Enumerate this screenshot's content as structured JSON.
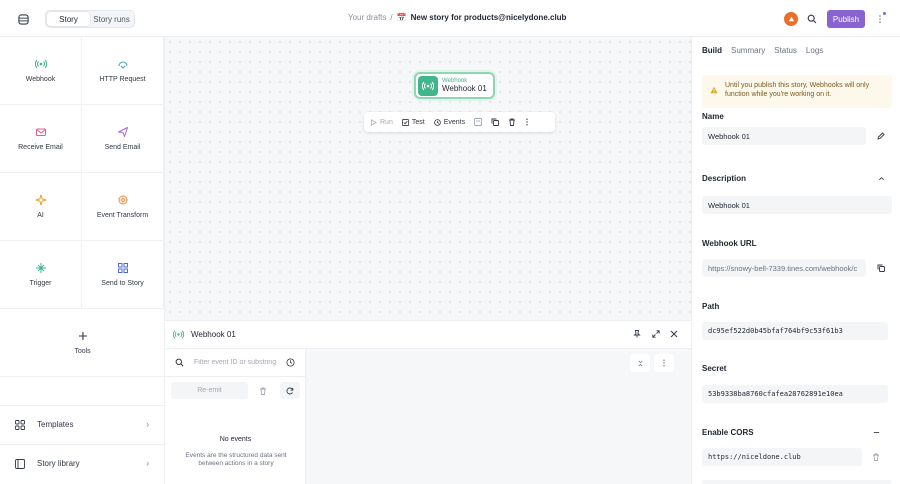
{
  "topbar": {
    "tabs": [
      {
        "label": "Story",
        "active": true
      },
      {
        "label": "Story runs",
        "active": false
      }
    ],
    "breadcrumb_root": "Your drafts",
    "breadcrumb_sep": "/",
    "story_emoji": "📅",
    "story_title": "New story for products@nicelydone.club",
    "publish_label": "Publish"
  },
  "sidebar": {
    "tools": [
      {
        "label": "Webhook",
        "icon": "webhook-icon"
      },
      {
        "label": "HTTP Request",
        "icon": "http-request-icon"
      },
      {
        "label": "Receive Email",
        "icon": "receive-email-icon"
      },
      {
        "label": "Send Email",
        "icon": "send-email-icon"
      },
      {
        "label": "AI",
        "icon": "ai-sparkle-icon"
      },
      {
        "label": "Event Transform",
        "icon": "event-transform-icon"
      },
      {
        "label": "Trigger",
        "icon": "trigger-icon"
      },
      {
        "label": "Send to Story",
        "icon": "send-to-story-icon"
      },
      {
        "label": "Tools",
        "icon": "plus-icon"
      }
    ],
    "links": [
      {
        "label": "Templates"
      },
      {
        "label": "Story library"
      }
    ]
  },
  "canvas": {
    "node": {
      "type_label": "Webhook",
      "name": "Webhook 01"
    },
    "node_actions": [
      {
        "label": "Run",
        "enabled": false
      },
      {
        "label": "Test",
        "enabled": true
      },
      {
        "label": "Events",
        "enabled": true
      }
    ]
  },
  "events_panel": {
    "title": "Webhook 01",
    "filter_placeholder": "Filter event ID or substring",
    "reemit_label": "Re-emit",
    "empty_title": "No events",
    "empty_subtitle": "Events are the structured data sent between actions in a story"
  },
  "right_panel": {
    "tabs": [
      {
        "label": "Build",
        "active": true
      },
      {
        "label": "Summary",
        "active": false
      },
      {
        "label": "Status",
        "active": false
      },
      {
        "label": "Logs",
        "active": false
      }
    ],
    "warning": "Until you publish this story, Webhooks will only function while you're working on it.",
    "name_label": "Name",
    "name_value": "Webhook 01",
    "description_label": "Description",
    "description_value": "Webhook 01",
    "webhook_url_label": "Webhook URL",
    "webhook_url_value": "https://snowy-bell-7339.tines.com/webhook/c",
    "path_label": "Path",
    "path_value": "dc95ef522d0b45bfaf764bf9c53f61b3",
    "secret_label": "Secret",
    "secret_value": "53b9338ba8760cfafea28762891e10ea",
    "cors_label": "Enable CORS",
    "cors_value": "https://niceldone.club"
  },
  "colors": {
    "accent": "#8a63d2",
    "webhook_green": "#3fb68b",
    "warning_bg": "#fdf8ec"
  }
}
